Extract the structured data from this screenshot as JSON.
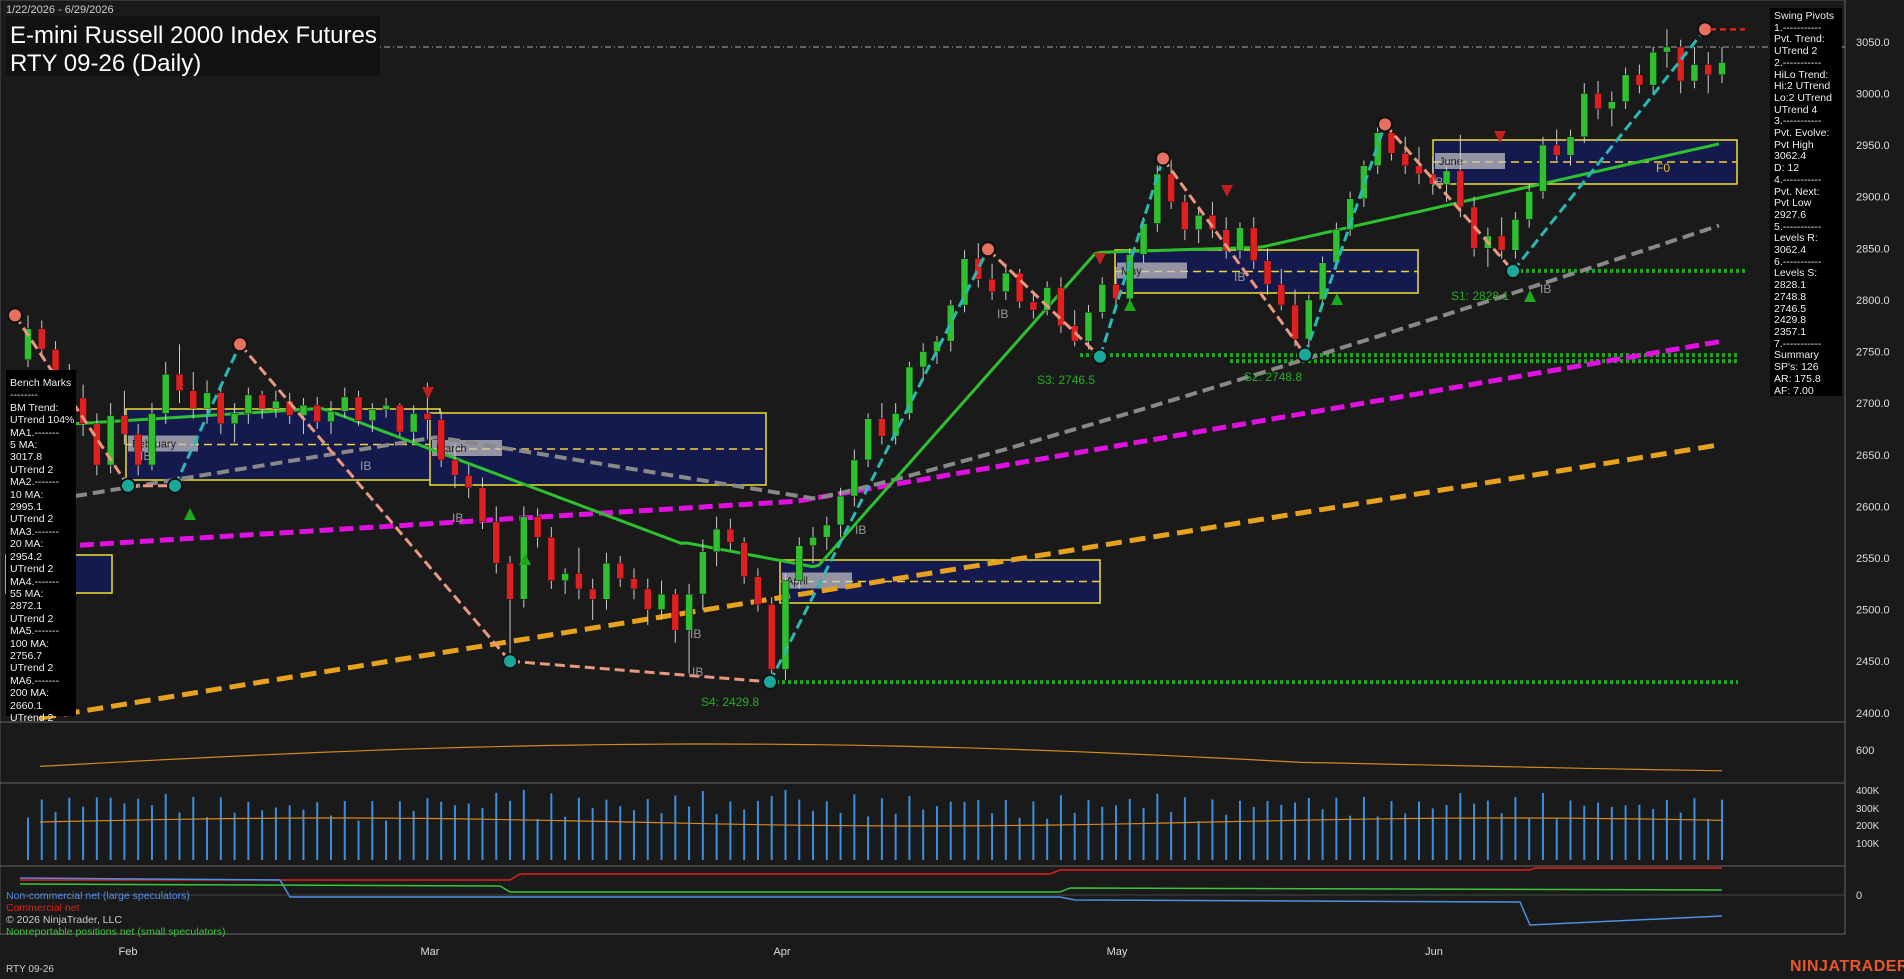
{
  "title": "E-mini Russell 2000 Index Futures",
  "subtitle": "RTY 09-26 (Daily)",
  "date_range": "1/22/2026 - 6/29/2026",
  "footer_symbol": "RTY 09-26",
  "brand": "NINJATRADER",
  "copyright": "© 2026 NinjaTrader, LLC",
  "bench_marks": [
    "Bench Marks",
    "--------",
    "BM Trend:",
    "UTrend 104%",
    "MA1.-------",
    "5 MA:",
    "3017.8",
    "UTrend 2",
    "MA2.-------",
    "10 MA:",
    "2995.1",
    "UTrend 2",
    "MA3.-------",
    "20 MA:",
    "2954.2",
    "UTrend 2",
    "MA4.-------",
    "55 MA:",
    "2872.1",
    "UTrend 2",
    "MA5.-------",
    "100 MA:",
    "2756.7",
    "UTrend 2",
    "MA6.-------",
    "200 MA:",
    "2660.1",
    "UTrend 2"
  ],
  "swing_pivots": [
    "Swing Pivots",
    "1.-----------",
    "Pvt. Trend:",
    "UTrend 2",
    "2.-----------",
    "HiLo Trend:",
    "Hi:2 UTrend",
    "Lo:2 UTrend",
    "UTrend 4",
    "3.-----------",
    "Pvt. Evolve:",
    "Pvt High",
    "3062.4",
    "D: 12",
    "4.-----------",
    "Pvt. Next:",
    "Pvt Low",
    "2927.6",
    "5.-----------",
    "Levels R:",
    "3062.4",
    "6.-----------",
    "Levels S:",
    "2828.1",
    "2748.8",
    "2746.5",
    "2429.8",
    "2357.1",
    "7.-----------",
    "Summary",
    "SP's: 126",
    "AR: 175.8",
    "AF: 7.00"
  ],
  "cot_legend": [
    {
      "label": "Non-commercial net (large speculators)",
      "color": "#4f8fe6"
    },
    {
      "label": "Commercial net",
      "color": "#e02020"
    },
    {
      "label": "Nonreportable positions net (small speculators)",
      "color": "#3cc43c"
    }
  ],
  "chart_data": {
    "type": "candlestick",
    "x_labels": [
      "Feb",
      "Mar",
      "Apr",
      "May",
      "Jun"
    ],
    "price_axis": {
      "ticks": [
        2400,
        2450,
        2500,
        2550,
        2600,
        2650,
        2700,
        2750,
        2800,
        2850,
        2900,
        2950,
        3000,
        3050
      ],
      "ylim": [
        2395,
        3075
      ]
    },
    "volume_axis": {
      "ticks": [
        "400K",
        "300K",
        "200K",
        "100K"
      ]
    },
    "atr_axis": {
      "ticks": [
        "600"
      ]
    },
    "cot_axis": {
      "ticks": [
        "0"
      ]
    },
    "reference_line": 3045,
    "candles": [
      [
        2742,
        2785,
        2735,
        2772
      ],
      [
        2772,
        2780,
        2745,
        2752
      ],
      [
        2752,
        2760,
        2710,
        2720
      ],
      [
        2720,
        2738,
        2690,
        2705
      ],
      [
        2705,
        2718,
        2668,
        2680
      ],
      [
        2680,
        2690,
        2630,
        2640
      ],
      [
        2640,
        2700,
        2632,
        2688
      ],
      [
        2688,
        2712,
        2660,
        2670
      ],
      [
        2670,
        2680,
        2630,
        2640
      ],
      [
        2640,
        2700,
        2635,
        2690
      ],
      [
        2690,
        2740,
        2680,
        2728
      ],
      [
        2728,
        2757,
        2700,
        2712
      ],
      [
        2712,
        2730,
        2685,
        2695
      ],
      [
        2695,
        2722,
        2680,
        2710
      ],
      [
        2710,
        2715,
        2670,
        2680
      ],
      [
        2680,
        2700,
        2662,
        2690
      ],
      [
        2690,
        2715,
        2680,
        2708
      ],
      [
        2708,
        2712,
        2685,
        2695
      ],
      [
        2695,
        2712,
        2686,
        2702
      ],
      [
        2702,
        2710,
        2680,
        2688
      ],
      [
        2688,
        2705,
        2670,
        2698
      ],
      [
        2698,
        2706,
        2675,
        2682
      ],
      [
        2682,
        2702,
        2670,
        2692
      ],
      [
        2692,
        2715,
        2686,
        2706
      ],
      [
        2706,
        2712,
        2678,
        2683
      ],
      [
        2683,
        2700,
        2672,
        2694
      ],
      [
        2694,
        2705,
        2686,
        2698
      ],
      [
        2698,
        2700,
        2668,
        2672
      ],
      [
        2672,
        2698,
        2662,
        2690
      ],
      [
        2690,
        2720,
        2665,
        2684
      ],
      [
        2684,
        2692,
        2638,
        2645
      ],
      [
        2645,
        2660,
        2618,
        2630
      ],
      [
        2630,
        2640,
        2608,
        2618
      ],
      [
        2618,
        2628,
        2578,
        2585
      ],
      [
        2585,
        2600,
        2535,
        2545
      ],
      [
        2545,
        2552,
        2452,
        2510
      ],
      [
        2510,
        2600,
        2502,
        2590
      ],
      [
        2590,
        2598,
        2560,
        2570
      ],
      [
        2570,
        2580,
        2520,
        2528
      ],
      [
        2528,
        2540,
        2515,
        2535
      ],
      [
        2535,
        2560,
        2510,
        2520
      ],
      [
        2520,
        2530,
        2490,
        2510
      ],
      [
        2510,
        2555,
        2500,
        2545
      ],
      [
        2545,
        2552,
        2522,
        2530
      ],
      [
        2530,
        2540,
        2510,
        2520
      ],
      [
        2520,
        2530,
        2485,
        2500
      ],
      [
        2500,
        2528,
        2490,
        2515
      ],
      [
        2515,
        2520,
        2468,
        2480
      ],
      [
        2480,
        2525,
        2438,
        2515
      ],
      [
        2515,
        2568,
        2500,
        2556
      ],
      [
        2556,
        2590,
        2542,
        2578
      ],
      [
        2578,
        2588,
        2558,
        2565
      ],
      [
        2565,
        2570,
        2525,
        2532
      ],
      [
        2532,
        2540,
        2498,
        2505
      ],
      [
        2505,
        2512,
        2432,
        2442
      ],
      [
        2442,
        2535,
        2432,
        2528
      ],
      [
        2528,
        2570,
        2520,
        2562
      ],
      [
        2562,
        2580,
        2545,
        2570
      ],
      [
        2570,
        2590,
        2558,
        2582
      ],
      [
        2582,
        2618,
        2570,
        2610
      ],
      [
        2610,
        2655,
        2600,
        2645
      ],
      [
        2645,
        2690,
        2638,
        2685
      ],
      [
        2685,
        2700,
        2660,
        2668
      ],
      [
        2668,
        2700,
        2660,
        2690
      ],
      [
        2690,
        2740,
        2684,
        2735
      ],
      [
        2735,
        2758,
        2722,
        2750
      ],
      [
        2750,
        2765,
        2738,
        2760
      ],
      [
        2760,
        2800,
        2750,
        2795
      ],
      [
        2795,
        2848,
        2788,
        2840
      ],
      [
        2840,
        2855,
        2812,
        2820
      ],
      [
        2820,
        2835,
        2800,
        2808
      ],
      [
        2808,
        2835,
        2800,
        2826
      ],
      [
        2826,
        2830,
        2792,
        2798
      ],
      [
        2798,
        2808,
        2782,
        2790
      ],
      [
        2790,
        2818,
        2785,
        2812
      ],
      [
        2812,
        2822,
        2768,
        2775
      ],
      [
        2775,
        2790,
        2755,
        2760
      ],
      [
        2760,
        2795,
        2752,
        2788
      ],
      [
        2788,
        2822,
        2782,
        2815
      ],
      [
        2815,
        2832,
        2796,
        2801
      ],
      [
        2801,
        2850,
        2795,
        2844
      ],
      [
        2844,
        2880,
        2836,
        2874
      ],
      [
        2874,
        2930,
        2866,
        2922
      ],
      [
        2922,
        2936,
        2888,
        2895
      ],
      [
        2895,
        2902,
        2858,
        2868
      ],
      [
        2868,
        2890,
        2855,
        2882
      ],
      [
        2882,
        2895,
        2860,
        2868
      ],
      [
        2868,
        2880,
        2840,
        2848
      ],
      [
        2848,
        2875,
        2840,
        2870
      ],
      [
        2870,
        2880,
        2830,
        2838
      ],
      [
        2838,
        2850,
        2805,
        2815
      ],
      [
        2815,
        2830,
        2790,
        2795
      ],
      [
        2795,
        2810,
        2755,
        2762
      ],
      [
        2762,
        2805,
        2752,
        2800
      ],
      [
        2800,
        2842,
        2795,
        2836
      ],
      [
        2836,
        2875,
        2830,
        2868
      ],
      [
        2868,
        2905,
        2862,
        2898
      ],
      [
        2898,
        2935,
        2890,
        2930
      ],
      [
        2930,
        2968,
        2922,
        2962
      ],
      [
        2962,
        2965,
        2935,
        2942
      ],
      [
        2942,
        2958,
        2922,
        2930
      ],
      [
        2930,
        2948,
        2912,
        2922
      ],
      [
        2922,
        2938,
        2902,
        2912
      ],
      [
        2912,
        2930,
        2895,
        2925
      ],
      [
        2925,
        2960,
        2880,
        2890
      ],
      [
        2890,
        2900,
        2842,
        2850
      ],
      [
        2850,
        2870,
        2832,
        2862
      ],
      [
        2862,
        2880,
        2840,
        2848
      ],
      [
        2848,
        2885,
        2840,
        2878
      ],
      [
        2878,
        2912,
        2870,
        2905
      ],
      [
        2905,
        2958,
        2898,
        2950
      ],
      [
        2950,
        2965,
        2935,
        2940
      ],
      [
        2940,
        2965,
        2930,
        2958
      ],
      [
        2958,
        3010,
        2952,
        3000
      ],
      [
        3000,
        3012,
        2975,
        2985
      ],
      [
        2985,
        3002,
        2968,
        2992
      ],
      [
        2992,
        3025,
        2985,
        3018
      ],
      [
        3018,
        3028,
        3000,
        3008
      ],
      [
        3008,
        3045,
        3000,
        3040
      ],
      [
        3040,
        3062,
        3025,
        3045
      ],
      [
        3045,
        3052,
        3000,
        3012
      ],
      [
        3012,
        3045,
        3005,
        3028
      ],
      [
        3028,
        3040,
        3000,
        3018
      ],
      [
        3018,
        3045,
        3010,
        3030
      ]
    ],
    "annotations": [
      "IB",
      "S1: 2828.1",
      "S2: 2748.8",
      "S3: 2746.5",
      "S4: 2429.8",
      "F0"
    ],
    "value_areas": [
      "February",
      "March",
      "April",
      "May",
      "June"
    ]
  }
}
